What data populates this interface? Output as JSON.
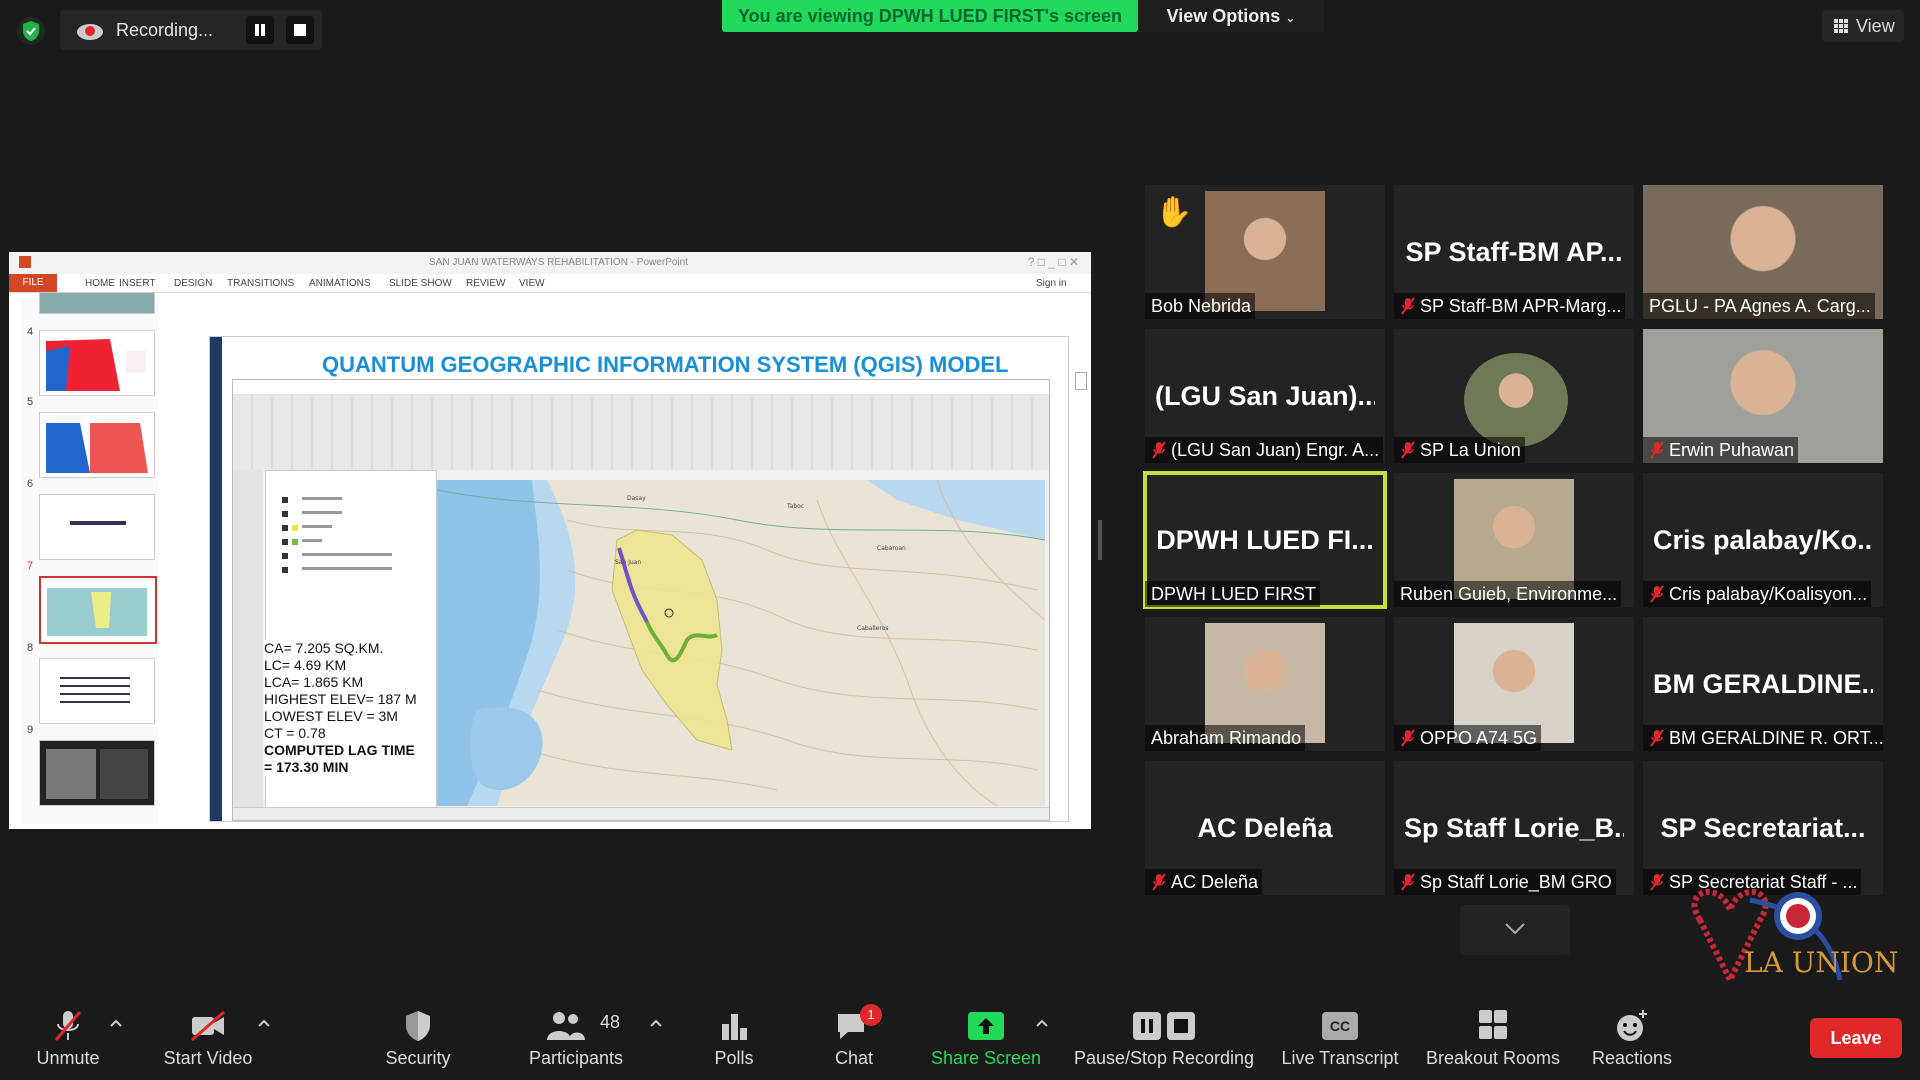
{
  "top": {
    "recording_label": "Recording...",
    "banner": "You are viewing DPWH LUED FIRST's screen",
    "view_options": "View Options",
    "view": "View"
  },
  "shared": {
    "window_title": "SAN JUAN WATERWAYS REHABILITATION - PowerPoint",
    "sign_in": "Sign in",
    "tabs": [
      "FILE",
      "HOME",
      "INSERT",
      "DESIGN",
      "TRANSITIONS",
      "ANIMATIONS",
      "SLIDE SHOW",
      "REVIEW",
      "VIEW"
    ],
    "slide_numbers": [
      "4",
      "5",
      "6",
      "7",
      "8",
      "9"
    ],
    "slide_title": "QUANTUM GEOGRAPHIC INFORMATION SYSTEM (QGIS) MODEL",
    "stats": [
      "CA= 7.205 SQ.KM.",
      "LC= 4.69 KM",
      "LCA= 1.865 KM",
      "HIGHEST ELEV= 187 M",
      "LOWEST ELEV = 3M",
      "CT = 0.78",
      "COMPUTED LAG TIME",
      "= 173.30 MIN"
    ],
    "map_places": [
      "San Juan",
      "Dasay",
      "Cabaroan",
      "Taboc",
      "Caballeros"
    ]
  },
  "participants": [
    {
      "big": "",
      "label": "Bob Nebrida",
      "muted": false,
      "hand": true
    },
    {
      "big": "SP  Staff-BM  AP...",
      "label": "SP Staff-BM APR-Marg...",
      "muted": true
    },
    {
      "big": "",
      "label": "PGLU - PA Agnes A. Carg...",
      "muted": false
    },
    {
      "big": "(LGU  San  Juan)...",
      "label": "(LGU San Juan) Engr. A...",
      "muted": true
    },
    {
      "big": "",
      "label": "SP La Union",
      "muted": true
    },
    {
      "big": "",
      "label": "Erwin  Puhawan",
      "muted": true
    },
    {
      "big": "DPWH  LUED  FI...",
      "label": "DPWH LUED FIRST",
      "muted": false,
      "active": true
    },
    {
      "big": "",
      "label": "Ruben Guieb, Environme...",
      "muted": false
    },
    {
      "big": "Cris  palabay/Ko...",
      "label": "Cris palabay/Koalisyon...",
      "muted": true
    },
    {
      "big": "",
      "label": "Abraham Rimando",
      "muted": false
    },
    {
      "big": "",
      "label": "OPPO A74 5G",
      "muted": true
    },
    {
      "big": "BM  GERALDINE...",
      "label": "BM GERALDINE R. ORT...",
      "muted": true
    },
    {
      "big": "AC Deleña",
      "label": "AC Deleña",
      "muted": true
    },
    {
      "big": "Sp  Staff  Lorie_B...",
      "label": "Sp Staff Lorie_BM GRO",
      "muted": true
    },
    {
      "big": "SP   Secretariat...",
      "label": "SP  Secretariat Staff - ...",
      "muted": true
    }
  ],
  "logo_text": "LA UNION",
  "toolbar": {
    "unmute": "Unmute",
    "start_video": "Start Video",
    "security": "Security",
    "participants": "Participants",
    "participants_count": "48",
    "polls": "Polls",
    "chat": "Chat",
    "chat_badge": "1",
    "share_screen": "Share Screen",
    "pause_stop": "Pause/Stop Recording",
    "live_transcript": "Live Transcript",
    "cc": "CC",
    "breakout": "Breakout Rooms",
    "reactions": "Reactions",
    "leave": "Leave"
  },
  "colors": {
    "banner_green": "#23d959",
    "leave_red": "#e02828",
    "active_border": "#c4e03a",
    "slide_title_blue": "#1a8fd3",
    "muted_red": "#e02828"
  }
}
